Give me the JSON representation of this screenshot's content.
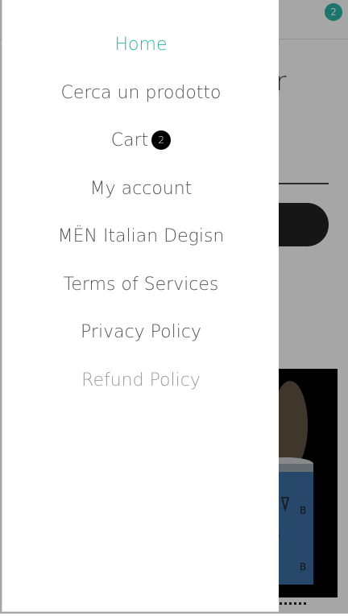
{
  "header": {
    "cart_count": "2"
  },
  "page": {
    "heading_fragment": "ter"
  },
  "drawer": {
    "items": [
      {
        "label": "Home",
        "state": "active"
      },
      {
        "label": "Cerca un prodotto"
      },
      {
        "label": "Cart",
        "badge": "2"
      },
      {
        "label": "My account"
      },
      {
        "label": "MËN Italian Degisn"
      },
      {
        "label": "Terms of Services"
      },
      {
        "label": "Privacy Policy"
      },
      {
        "label": "Refund Policy",
        "state": "faded"
      }
    ]
  },
  "colors": {
    "accent": "#2bb5a8",
    "text": "#555555",
    "muted": "#9a9a9a",
    "badge": "#000000"
  }
}
